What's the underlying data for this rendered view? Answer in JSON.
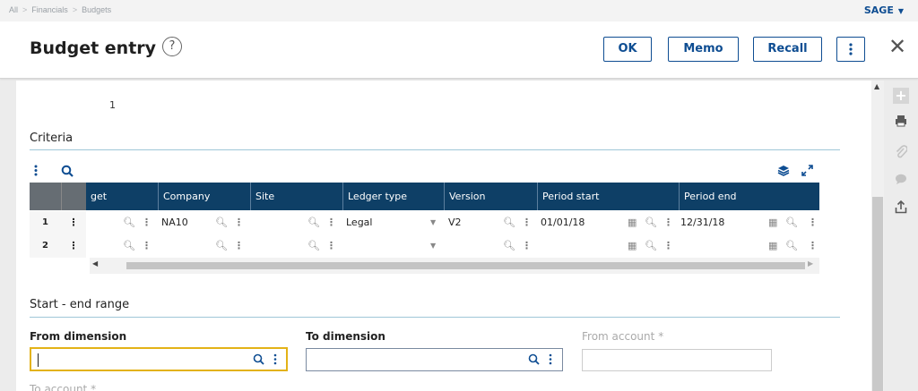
{
  "breadcrumb": [
    "All",
    "Financials",
    "Budgets"
  ],
  "user_menu": {
    "label": "SAGE"
  },
  "header": {
    "title": "Budget entry",
    "help_icon_glyph": "?",
    "buttons": {
      "ok": "OK",
      "memo": "Memo",
      "recall": "Recall"
    }
  },
  "top_value": "1",
  "criteria": {
    "title": "Criteria",
    "columns": [
      "get",
      "Company",
      "Site",
      "Ledger type",
      "Version",
      "Period start",
      "Period end"
    ],
    "rows": [
      {
        "num": "1",
        "budget": "",
        "company": "NA10",
        "site": "",
        "ledger_type": "Legal",
        "version": "V2",
        "period_start": "01/01/18",
        "period_end": "12/31/18"
      },
      {
        "num": "2",
        "budget": "",
        "company": "",
        "site": "",
        "ledger_type": "",
        "version": "",
        "period_start": "",
        "period_end": ""
      }
    ]
  },
  "range": {
    "title": "Start - end range",
    "from_dimension": {
      "label": "From dimension",
      "value": ""
    },
    "to_dimension": {
      "label": "To dimension",
      "value": ""
    },
    "from_account": {
      "label": "From account",
      "required_mark": "*",
      "value": ""
    },
    "to_account": {
      "label": "To account",
      "required_mark": "*"
    }
  },
  "colors": {
    "accent": "#0e4d92",
    "grid_header": "#0e3f66",
    "focus": "#e3b217",
    "section_line": "#9fc7d8"
  }
}
